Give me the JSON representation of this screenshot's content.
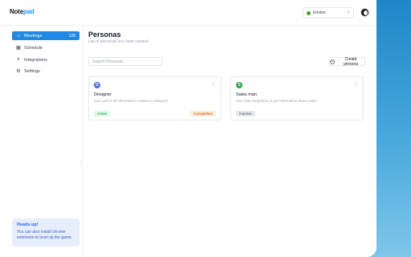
{
  "app": {
    "logo_main": "Note",
    "logo_accent": "pad"
  },
  "header": {
    "workspace_name": "Eriston",
    "workspace_color": "#4d9e1a",
    "chevron": "⌃⌄"
  },
  "sidebar": {
    "items": [
      {
        "label": "Meetings",
        "icon": "home-icon",
        "glyph": "⌂",
        "count": "128",
        "active": true
      },
      {
        "label": "Schedule",
        "icon": "calendar-icon",
        "glyph": "▦",
        "count": "",
        "active": false
      },
      {
        "label": "Integrations",
        "icon": "plug-icon",
        "glyph": "⟡",
        "count": "",
        "active": false
      },
      {
        "label": "Settings",
        "icon": "gear-icon",
        "glyph": "⚙",
        "count": "",
        "active": false
      }
    ],
    "tip": {
      "title": "Heads up!",
      "body": "You can also install chrome extension to level up the game"
    }
  },
  "main": {
    "title": "Personas",
    "subtitle": "List of personas you have created",
    "search_placeholder": "Search Personas",
    "create_label": "Create persona",
    "cards": [
      {
        "initial": "D",
        "avatar_color": "#4f6bed",
        "title": "Designer",
        "description": "Can collect all informations related to designer",
        "status": "Active",
        "extra": "3 properties"
      },
      {
        "initial": "S",
        "avatar_color": "#2ea44f",
        "title": "Sales man",
        "description": "Use clink integration to get information about sales",
        "status": "Inactive",
        "extra": ""
      }
    ]
  }
}
